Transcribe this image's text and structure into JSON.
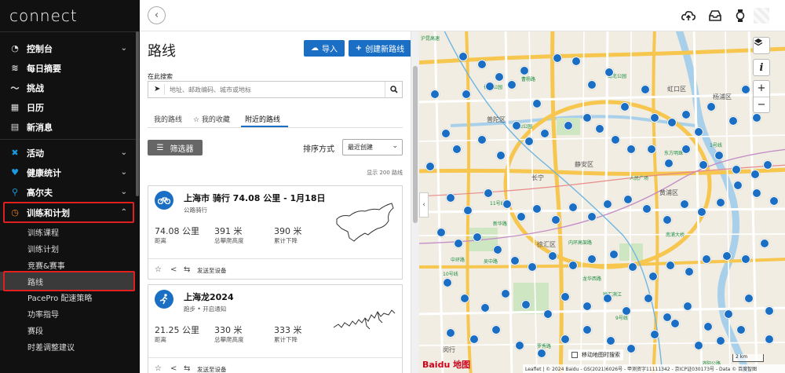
{
  "app": {
    "logo": "connect"
  },
  "sidebar": {
    "items": [
      {
        "label": "控制台",
        "icon": "dashboard-icon",
        "glyph": "◔",
        "chev": "⌄"
      },
      {
        "label": "每日摘要",
        "icon": "layers-icon",
        "glyph": "≋",
        "chev": ""
      },
      {
        "label": "挑战",
        "icon": "challenge-icon",
        "glyph": "〜",
        "chev": ""
      },
      {
        "label": "日历",
        "icon": "calendar-icon",
        "glyph": "▦",
        "chev": ""
      },
      {
        "label": "新消息",
        "icon": "news-icon",
        "glyph": "▤",
        "chev": ""
      },
      {
        "label": "活动",
        "icon": "activity-runner-icon",
        "glyph": "✖",
        "chev": "⌄"
      },
      {
        "label": "健康统计",
        "icon": "heart-icon",
        "glyph": "♥",
        "chev": "⌄"
      },
      {
        "label": "高尔夫",
        "icon": "golf-icon",
        "glyph": "⚲",
        "chev": "⌄"
      },
      {
        "label": "训练和计划",
        "icon": "stopwatch-icon",
        "glyph": "◷",
        "chev": "⌃"
      }
    ],
    "subitems": [
      {
        "label": "训练课程"
      },
      {
        "label": "训练计划"
      },
      {
        "label": "竞赛&赛事"
      },
      {
        "label": "路线"
      },
      {
        "label": "PacePro 配速策略"
      },
      {
        "label": "功率指导"
      },
      {
        "label": "赛段"
      },
      {
        "label": "时差调整建议"
      }
    ]
  },
  "topbar": {
    "back": "‹",
    "icons": [
      "upload-cloud-icon",
      "inbox-icon",
      "watch-icon"
    ]
  },
  "main": {
    "title": "路线",
    "import_label": "导入",
    "create_label": "创建新路线",
    "search_label": "在此搜索",
    "search_placeholder": "地址、邮政编码、城市或地标",
    "tabs": [
      {
        "label": "我的路线"
      },
      {
        "label": "☆ 我的收藏"
      },
      {
        "label": "附近的路线"
      }
    ],
    "filter_label": "筛选器",
    "sort_label": "排序方式",
    "sort_value": "最近创建",
    "count_text": "显示 200 路线",
    "cards": [
      {
        "title": "上海市 骑行 74.08 公里 - 1月18日",
        "subtitle": "公路骑行",
        "icon": "bike-icon",
        "glyph": "⚲",
        "stats": [
          {
            "value": "74.08 公里",
            "label": "距离"
          },
          {
            "value": "391 米",
            "label": "总攀爬高度"
          },
          {
            "value": "390 米",
            "label": "累计下降"
          }
        ],
        "send": "发送至设备"
      },
      {
        "title": "上海龙2024",
        "subtitle": "跑步 • 开启通知",
        "icon": "run-icon",
        "glyph": "✖",
        "stats": [
          {
            "value": "21.25 公里",
            "label": "距离"
          },
          {
            "value": "330 米",
            "label": "总攀爬高度"
          },
          {
            "value": "333 米",
            "label": "累计下降"
          }
        ],
        "send": "发送至设备"
      }
    ]
  },
  "map": {
    "move_search": "移动地图时搜索",
    "scale": "2 km",
    "attribution": "Leaflet | © 2024 Baidu - GS(2021)6026号 - 甲测资字11111342 - 京ICP证030173号 - Data © 百度智图",
    "logo": "Baidu 地图",
    "districts": [
      "普陀区",
      "静安区",
      "长宁",
      "徐汇区",
      "虹口区",
      "杨浦区",
      "黄浦区",
      "闵行"
    ],
    "labels": [
      "沪昆高速",
      "南北公园",
      "中山公园",
      "新华路",
      "内环高架路",
      "中环路",
      "吴中路",
      "龙华西路",
      "曹杨路",
      "东方明珠",
      "人民广场",
      "南浦大桥",
      "10号线",
      "11号线",
      "9号线",
      "1号线",
      "罗秀路",
      "济阳公路",
      "徐汇滨江",
      "长风公园"
    ],
    "layers_icon": "layers-icon",
    "info_icon": "info-icon",
    "zoom_in": "+",
    "zoom_out": "−"
  }
}
